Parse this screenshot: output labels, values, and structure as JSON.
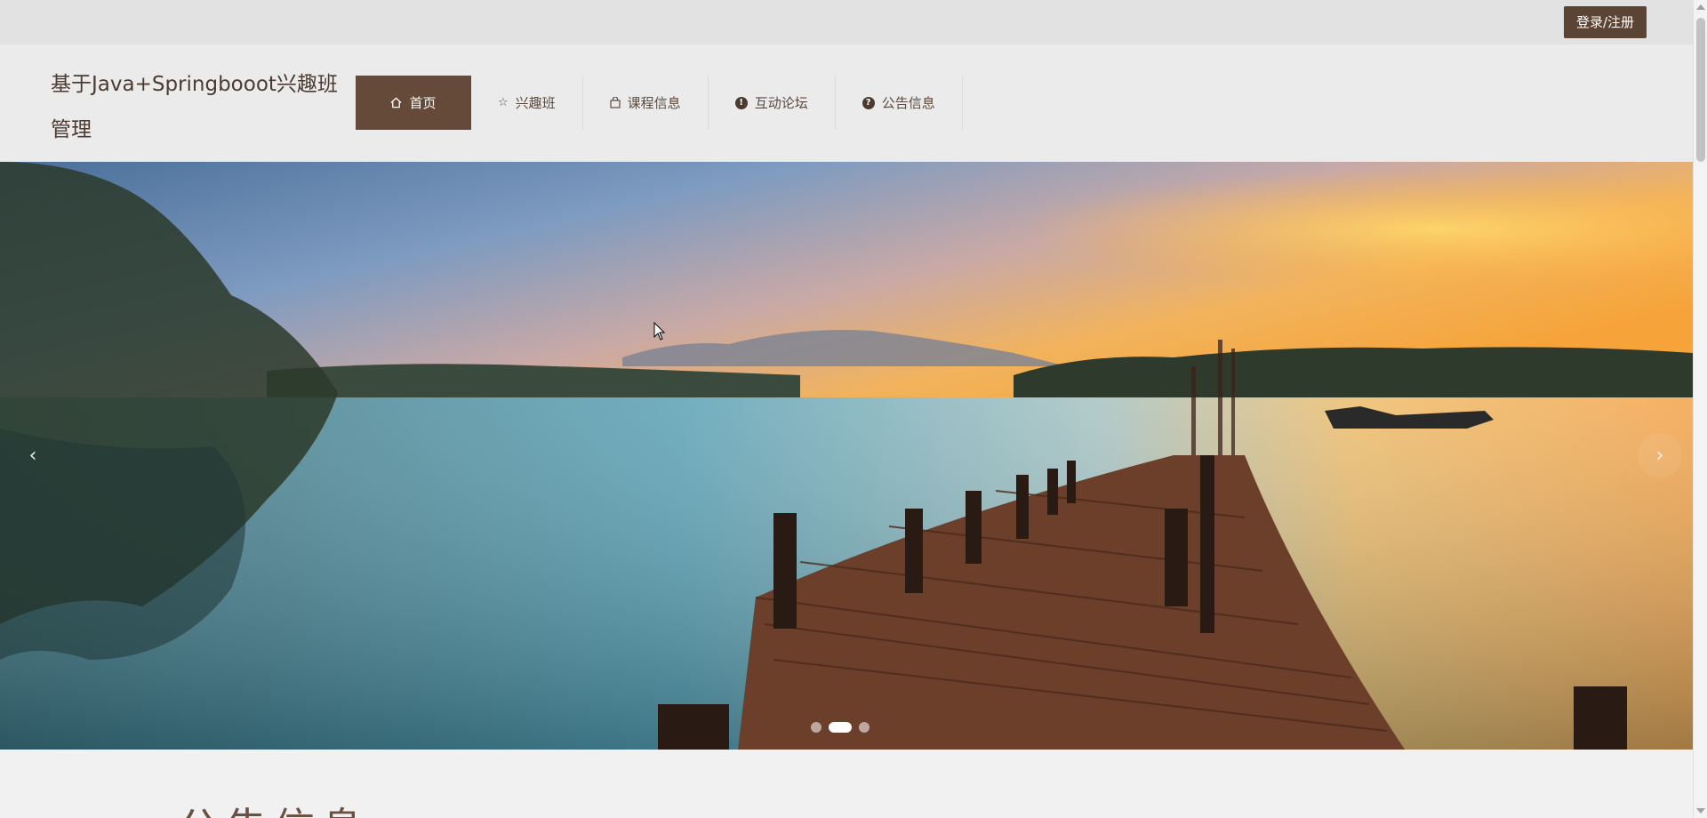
{
  "topbar": {
    "login_label": "登录/注册"
  },
  "header": {
    "site_title": "基于Java+Springbooot兴趣班管理"
  },
  "nav": {
    "items": [
      {
        "label": "首页",
        "icon": "home-icon",
        "active": true
      },
      {
        "label": "兴趣班",
        "icon": "star-icon",
        "active": false
      },
      {
        "label": "课程信息",
        "icon": "bag-icon",
        "active": false
      },
      {
        "label": "互动论坛",
        "icon": "exclamation-circle-icon",
        "active": false
      },
      {
        "label": "公告信息",
        "icon": "question-circle-icon",
        "active": false
      }
    ]
  },
  "banner": {
    "image": "lake-sunset-wooden-pier",
    "prev_icon": "chevron-left-icon",
    "next_icon": "chevron-right-icon",
    "slide_count": 3,
    "active_slide": 2
  },
  "section": {
    "heading": "公告信息"
  },
  "colors": {
    "brand": "#654a3a",
    "login_button": "#5c4435",
    "title_text": "#4b3b32",
    "nav_text": "#5d4a3e"
  }
}
